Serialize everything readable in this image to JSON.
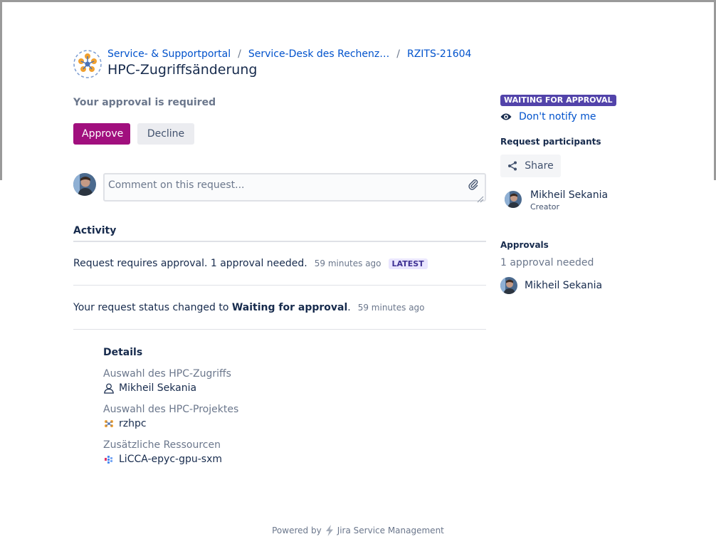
{
  "breadcrumbs": {
    "portal": "Service- & Supportportal",
    "desk": "Service-Desk des Rechenz…",
    "ticket": "RZITS-21604",
    "separator": "/"
  },
  "page": {
    "title": "HPC-Zugriffsänderung"
  },
  "approval": {
    "required_text": "Your approval is required",
    "approve_label": "Approve",
    "decline_label": "Decline",
    "accent_color": "#a10f7e"
  },
  "comment": {
    "placeholder": "Comment on this request...",
    "value": ""
  },
  "activity": {
    "heading": "Activity",
    "items": [
      {
        "text": "Request requires approval. 1 approval needed.",
        "time": "59 minutes ago",
        "badge": "LATEST"
      },
      {
        "text_prefix": "Your request status changed to ",
        "text_bold": "Waiting for approval",
        "text_suffix": ".",
        "time": "59 minutes ago"
      }
    ]
  },
  "details": {
    "heading": "Details",
    "fields": [
      {
        "label": "Auswahl des HPC-Zugriffs",
        "value": "Mikheil Sekania",
        "icon": "user-icon"
      },
      {
        "label": "Auswahl des HPC-Projektes",
        "value": "rzhpc",
        "icon": "project-icon"
      },
      {
        "label": "Zusätzliche Ressourcen",
        "value": "LiCCA-epyc-gpu-sxm",
        "icon": "resource-icon"
      }
    ]
  },
  "sidebar": {
    "status": "WAITING FOR APPROVAL",
    "status_color": "#5243aa",
    "notify_label": "Don't notify me",
    "participants_heading": "Request participants",
    "share_label": "Share",
    "participant": {
      "name": "Mikheil Sekania",
      "role": "Creator"
    },
    "approvals_heading": "Approvals",
    "approvals_needed": "1 approval needed",
    "approver": {
      "name": "Mikheil Sekania"
    }
  },
  "footer": {
    "powered_by": "Powered by",
    "product": "Jira Service Management"
  }
}
